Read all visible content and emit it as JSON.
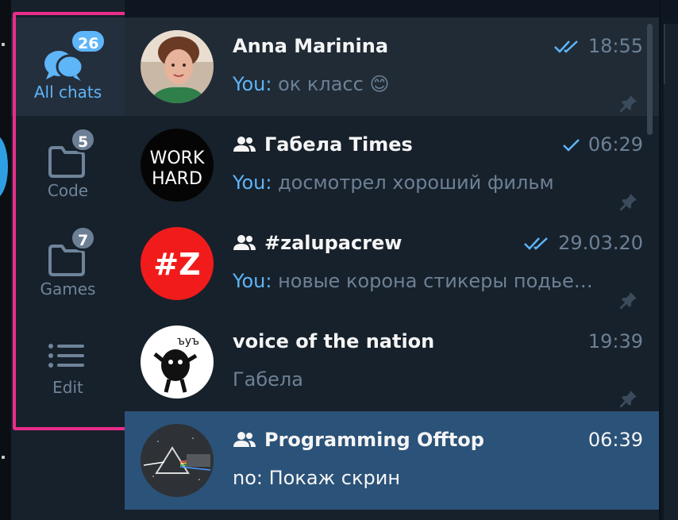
{
  "folders": [
    {
      "label": "All chats",
      "badge": "26",
      "icon": "chat-bubbles-icon"
    },
    {
      "label": "Code",
      "badge": "5",
      "icon": "folder-icon"
    },
    {
      "label": "Games",
      "badge": "7",
      "icon": "folder-icon"
    },
    {
      "label": "Edit",
      "badge": "",
      "icon": "list-icon"
    }
  ],
  "chats": [
    {
      "title": "Anna Marinina",
      "sender": "You:",
      "message": " ок класс 😊",
      "time": "18:55",
      "status": "double-check",
      "group": false,
      "pinned": true
    },
    {
      "title": "Габела Times",
      "sender": "You:",
      "message": " досмотрел хороший фильм",
      "time": "06:29",
      "status": "single-check",
      "group": true,
      "pinned": true
    },
    {
      "title": "#zalupacrew",
      "sender": "You:",
      "message": " новые корона стикеры подье…",
      "time": "29.03.20",
      "status": "double-check",
      "group": true,
      "pinned": true
    },
    {
      "title": "voice of the nation",
      "sender": "",
      "message": "Габела",
      "time": "19:39",
      "status": "",
      "group": false,
      "pinned": true
    },
    {
      "title": "Programming Offtop",
      "sender": "no:",
      "message": " Покаж скрин",
      "time": "06:39",
      "status": "",
      "group": true,
      "pinned": false
    }
  ],
  "avatars": {
    "work_hard_line1": "WORK",
    "work_hard_line2": "HARD",
    "zalupa": "#Z",
    "voice_tag": "ъуъ"
  },
  "colors": {
    "accent": "#5eb5f7",
    "highlight": "#ea2d8a",
    "active_row": "#2b5278",
    "sidebar": "#17212b"
  }
}
